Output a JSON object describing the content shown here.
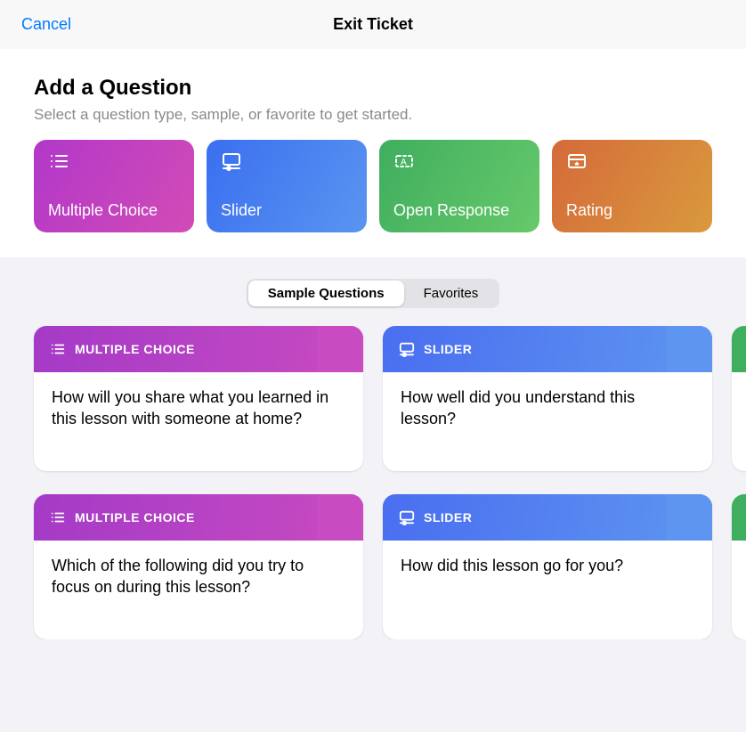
{
  "nav": {
    "cancel": "Cancel",
    "title": "Exit Ticket"
  },
  "addQuestion": {
    "heading": "Add a Question",
    "subtitle": "Select a question type, sample, or favorite to get started."
  },
  "questionTypes": [
    {
      "id": "multiple-choice",
      "label": "Multiple Choice",
      "icon": "list-icon",
      "colorClass": "bg-mc"
    },
    {
      "id": "slider",
      "label": "Slider",
      "icon": "slider-icon",
      "colorClass": "bg-slider"
    },
    {
      "id": "open-response",
      "label": "Open Response",
      "icon": "textbox-icon",
      "colorClass": "bg-open"
    },
    {
      "id": "rating",
      "label": "Rating",
      "icon": "star-icon",
      "colorClass": "bg-rating"
    }
  ],
  "segmented": {
    "options": [
      "Sample Questions",
      "Favorites"
    ],
    "selectedIndex": 0
  },
  "samples": [
    {
      "type": "multiple-choice",
      "typeLabel": "MULTIPLE CHOICE",
      "text": "How will you share what you learned in this lesson with someone at home?"
    },
    {
      "type": "slider",
      "typeLabel": "SLIDER",
      "text": "How well did you understand this lesson?"
    },
    {
      "type": "multiple-choice",
      "typeLabel": "MULTIPLE CHOICE",
      "text": "Which of the following did you try to focus on during this lesson?"
    },
    {
      "type": "slider",
      "typeLabel": "SLIDER",
      "text": "How did this lesson go for you?"
    }
  ],
  "colors": {
    "accentBlue": "#007aff",
    "multipleChoice": "#b138c9",
    "slider": "#3a6ff0",
    "openResponse": "#3fae5f",
    "rating": "#d56a3a"
  }
}
